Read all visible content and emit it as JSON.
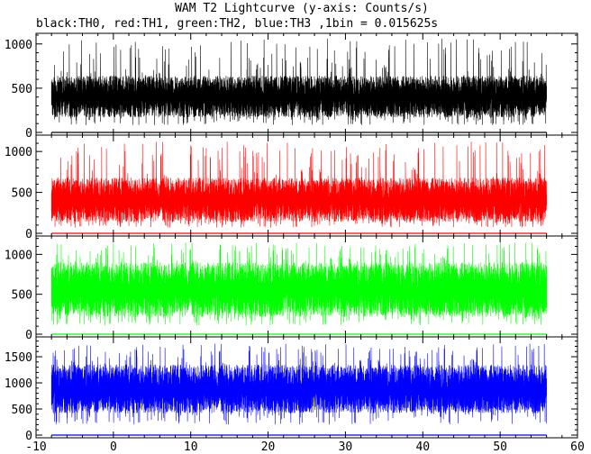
{
  "chart_data": {
    "type": "line",
    "title": "WAM T2 Lightcurve (y-axis: Counts/s)",
    "subtitle": "black:TH0, red:TH1, green:TH2, blue:TH3 ,1bin = 0.015625s",
    "x_range": [
      -8,
      56
    ],
    "xlim": [
      -10,
      60
    ],
    "x_ticks": [
      "-10",
      "0",
      "10",
      "20",
      "30",
      "40",
      "50",
      "60"
    ],
    "panels": [
      {
        "series": "TH0",
        "color": "#000000",
        "ylim": [
          0,
          1120
        ],
        "y_ticks": [
          "0",
          "500",
          "1000"
        ],
        "mean": 400,
        "low": 170,
        "high": 640,
        "spike_low": 80,
        "spike_high": 1060,
        "spike_prob": 0.05
      },
      {
        "series": "TH1",
        "color": "#ff0000",
        "ylim": [
          0,
          1200
        ],
        "y_ticks": [
          "0",
          "500",
          "1000"
        ],
        "mean": 400,
        "low": 140,
        "high": 680,
        "spike_low": 70,
        "spike_high": 1120,
        "spike_prob": 0.05
      },
      {
        "series": "TH2",
        "color": "#00ff00",
        "ylim": [
          0,
          1230
        ],
        "y_ticks": [
          "0",
          "500",
          "1000"
        ],
        "mean": 550,
        "low": 220,
        "high": 900,
        "spike_low": 110,
        "spike_high": 1150,
        "spike_prob": 0.05
      },
      {
        "series": "TH3",
        "color": "#0000ff",
        "ylim": [
          0,
          1880
        ],
        "y_ticks": [
          "0",
          "500",
          "1000",
          "1500"
        ],
        "mean": 850,
        "low": 420,
        "high": 1350,
        "spike_low": 200,
        "spike_high": 1750,
        "spike_prob": 0.05
      }
    ]
  }
}
